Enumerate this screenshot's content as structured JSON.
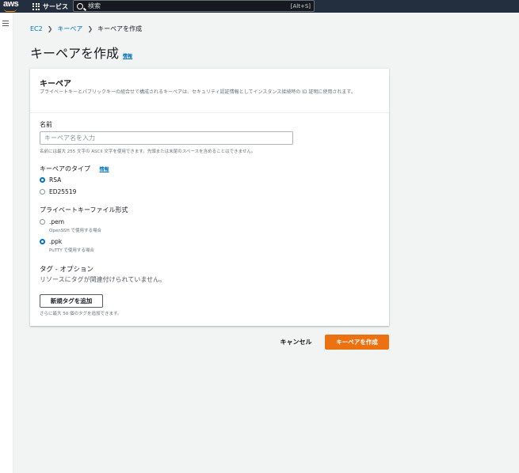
{
  "topbar": {
    "logo_text": "aws",
    "services_label": "サービス",
    "search_placeholder": "検索",
    "search_shortcut": "[Alt+S]"
  },
  "breadcrumb": {
    "items": [
      "EC2",
      "キーペア"
    ],
    "current": "キーペアを作成"
  },
  "page": {
    "title": "キーペアを作成",
    "info_label": "情報"
  },
  "card": {
    "title": "キーペア",
    "description": "プライベートキーとパブリックキーの組合せで構成されるキーペアは、セキュリティ認証情報としてインスタンス接続時の ID 証明に使用されます。"
  },
  "name_field": {
    "label": "名前",
    "placeholder": "キーペア名を入力",
    "value": "",
    "hint": "名前には最大 255 文字の ASCII 文字を使用できます。先頭または末尾のスペースを含めることはできません。"
  },
  "key_type": {
    "label": "キーペアのタイプ",
    "info_label": "情報",
    "options": [
      {
        "label": "RSA",
        "selected": true
      },
      {
        "label": "ED25519",
        "selected": false
      }
    ]
  },
  "key_format": {
    "label": "プライベートキーファイル形式",
    "options": [
      {
        "label": ".pem",
        "sub": "OpenSSH で使用する場合",
        "selected": false
      },
      {
        "label": ".ppk",
        "sub": "PuTTY で使用する場合",
        "selected": true
      }
    ]
  },
  "tags": {
    "title": "タグ - オプション",
    "empty_text": "リソースにタグが関連付けられていません。",
    "add_button": "新規タグを追加",
    "limit_hint": "さらに最大 50 個のタグを追加できます。"
  },
  "actions": {
    "cancel_label": "キャンセル",
    "create_label": "キーペアを作成"
  },
  "colors": {
    "topbar": "#232f3e",
    "link": "#0073bb",
    "primary_button": "#ec7211",
    "aws_accent": "#ff9900"
  }
}
